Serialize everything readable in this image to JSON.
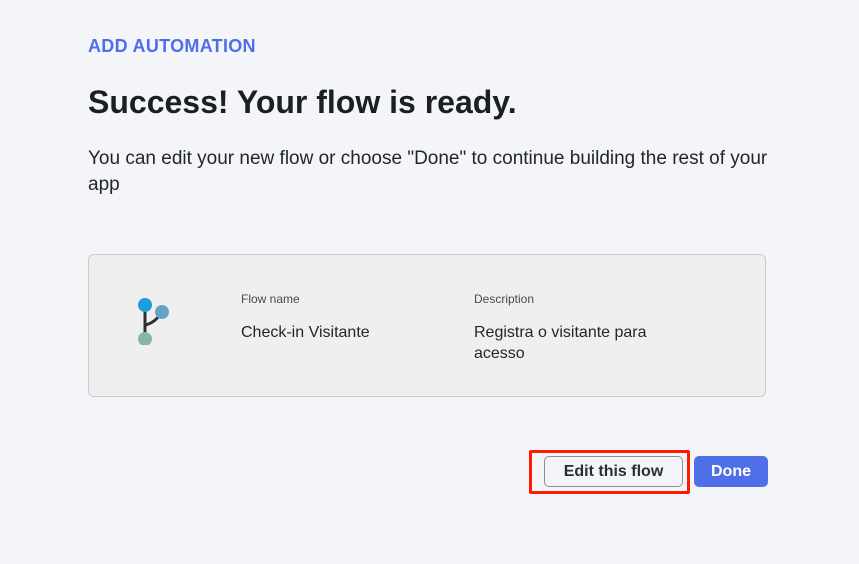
{
  "header": {
    "eyebrow": "ADD AUTOMATION",
    "title": "Success! Your flow is ready.",
    "subtitle": "You can edit your new flow or choose \"Done\" to continue building the rest of your app"
  },
  "flow_card": {
    "icon": "flow-branch-icon",
    "name_label": "Flow name",
    "name_value": "Check-in Visitante",
    "description_label": "Description",
    "description_value": "Registra o visitante para acesso"
  },
  "actions": {
    "edit_label": "Edit this flow",
    "done_label": "Done"
  },
  "colors": {
    "accent": "#4f6fe8",
    "highlight": "#ff1a00",
    "background": "#f4f5f8",
    "card": "#efefef"
  }
}
